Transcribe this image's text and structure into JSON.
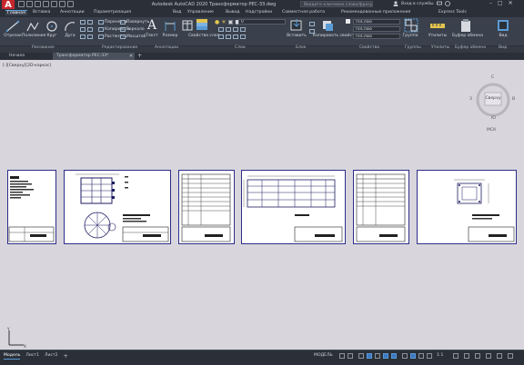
{
  "titlebar": {
    "title": "Autodesk AutoCAD 2020   Трансформатор РЕС-ЗЗ.dwg",
    "search_placeholder": "Введите ключевое слово/фразу",
    "user": "Вход в службы",
    "logo_letter": "A"
  },
  "menu_tabs": [
    "Главная",
    "Вставка",
    "Аннотации",
    "Параметризация",
    "Вид",
    "Управление",
    "Вывод",
    "Надстройки",
    "Совместная работа",
    "Рекомендованные приложения",
    "Express Tools"
  ],
  "menu_active": "Главная",
  "ribbon": {
    "draw_tools": [
      "Отрезок",
      "Полилиния",
      "Круг",
      "Дуга"
    ],
    "edit_tools": [
      "Перенести",
      "Повернуть",
      "Копировать",
      "Зеркало",
      "Растянуть",
      "Масштаб"
    ],
    "text_tool": "Текст",
    "dim_tool": "Размер",
    "table_tool": "Таблица",
    "layer_props": "Свойства слоя",
    "insert_tool": "Вставить",
    "match_props": "Копировать свойства",
    "layer_dropdown": "0",
    "prop_color": "ПоСлою",
    "prop_line": "ПоСлою",
    "prop_weight": "ПоСлою",
    "group_tool": "Группа",
    "utilities": "Утилиты",
    "clipboard": "Буфер обмена",
    "base": "Вид",
    "labels": [
      "Рисование",
      "Редактирование",
      "Аннотации",
      "Слои",
      "Блок",
      "Свойства",
      "Группы",
      "Утилиты",
      "Буфер обмена",
      "Вид"
    ]
  },
  "file_tabs": [
    "Начало",
    "Трансформатор РЕС-ЗЗ*"
  ],
  "file_tab_active": 1,
  "canvas": {
    "viewport_label": "[-][Сверху][2D-каркас]",
    "viewcube_top": "Сверху",
    "viewcube_c": "С",
    "viewcube_w": "З",
    "viewcube_e": "В",
    "viewcube_s": "Ю",
    "wcs": "МСК",
    "sheets": [
      "Лист 1",
      "Лист 2",
      "Лист 3",
      "Лист 4",
      "Лист 5",
      "Лист 6"
    ]
  },
  "status": {
    "layout_tabs": [
      "Модель",
      "Лист1",
      "Лист2"
    ],
    "model_label": "МОДЕЛЬ",
    "scale": "1:1",
    "icons": [
      "grid",
      "snap",
      "ortho",
      "polar",
      "osnap",
      "otrack",
      "lineweight",
      "transparency",
      "selection",
      "annotation",
      "workspace",
      "customize"
    ]
  },
  "colors": {
    "accent": "#5b9bd5",
    "sheet_border": "#2d2d8a",
    "canvas_bg": "#d8d6dc",
    "ribbon_bg": "#3a414c",
    "logo": "#c8262d"
  }
}
